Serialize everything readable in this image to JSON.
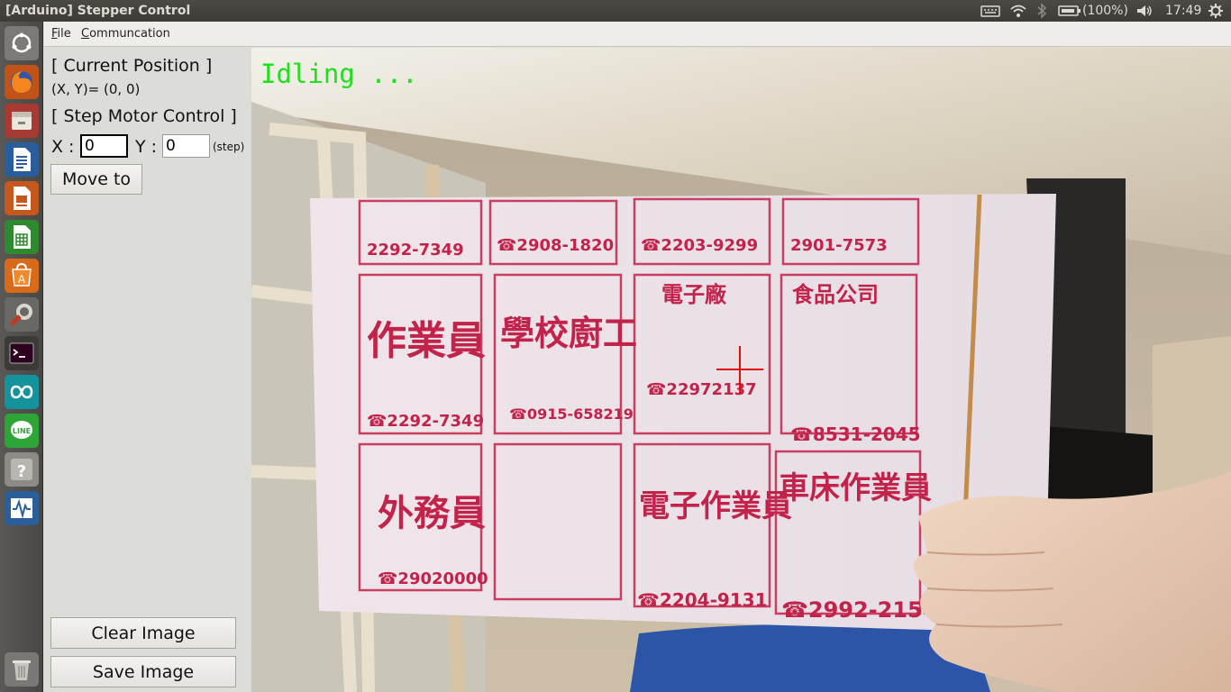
{
  "window": {
    "title": "[Arduino] Stepper Control"
  },
  "tray": {
    "battery": "(100%)",
    "clock": "17:49"
  },
  "launcher": {
    "items": [
      "dash-icon",
      "firefox-icon",
      "files-icon",
      "writer-icon",
      "impress-icon",
      "calc-icon",
      "software-center-icon",
      "system-settings-icon",
      "terminal-icon",
      "arduino-icon",
      "line-icon",
      "help-icon",
      "system-monitor-icon",
      "trash-icon"
    ]
  },
  "menu": {
    "file": "File",
    "file_underline": "F",
    "file_rest": "ile",
    "comm": "Communcation",
    "comm_underline": "C",
    "comm_rest": "ommuncation"
  },
  "panel": {
    "current_position_heading": "[ Current Position ]",
    "position_text": "(X, Y)= (0, 0)",
    "step_control_heading": "[ Step Motor Control ]",
    "x_label": "X :",
    "x_value": "0",
    "y_label": "Y :",
    "y_value": "0",
    "unit": "(step)",
    "move_button": "Move to",
    "clear_button": "Clear Image",
    "save_button": "Save Image"
  },
  "camera": {
    "status": "Idling ...",
    "crosshair_color": "#e01010",
    "ads": [
      {
        "title": "作業員",
        "phone": "2292-7349"
      },
      {
        "title": "學校廚工",
        "phone": "0915-658219"
      },
      {
        "title": "電子廠",
        "phone": "22972137"
      },
      {
        "title": "食品公司",
        "phone": "8531-2045"
      },
      {
        "title": "外務員",
        "phone": "29020000"
      },
      {
        "title": "電子作業員",
        "phone": "2204-9131"
      },
      {
        "title": "車床作業員",
        "phone": "2992-2154"
      }
    ]
  },
  "colors": {
    "status_green": "#1fe01f",
    "ad_red": "#c2234a"
  }
}
